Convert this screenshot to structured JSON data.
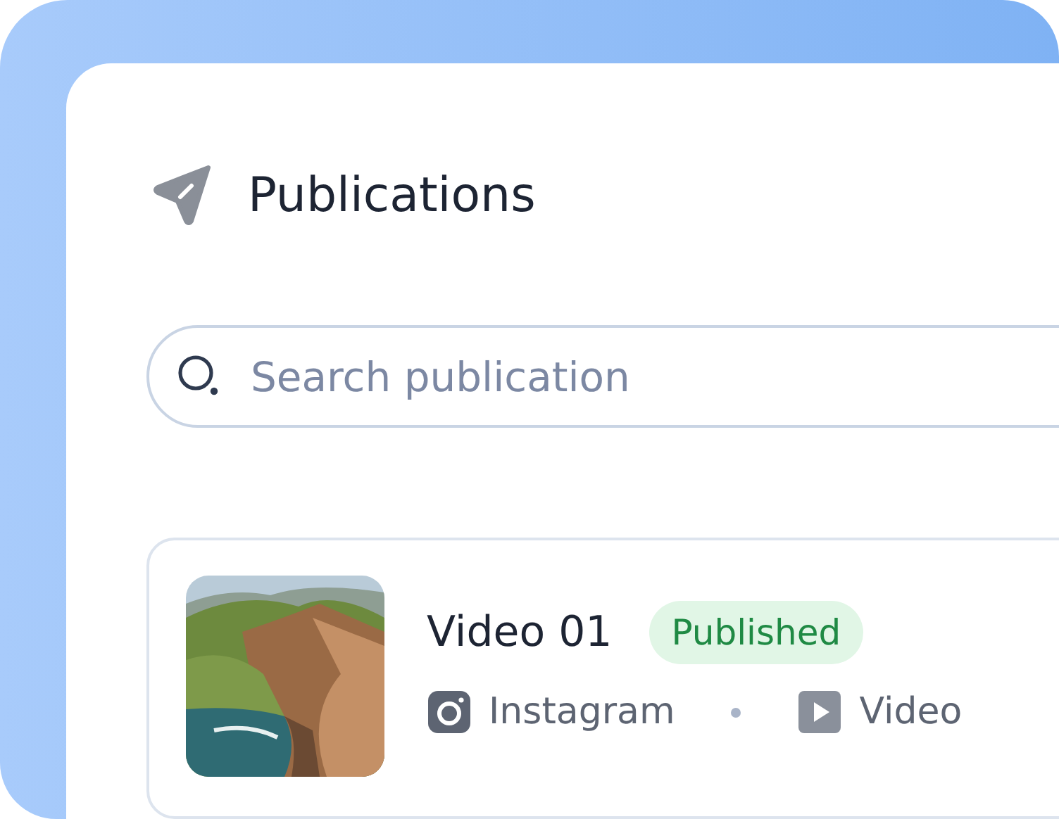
{
  "title": "Publications",
  "search": {
    "placeholder": "Search publication"
  },
  "publications": [
    {
      "title": "Video 01",
      "status": {
        "label": "Published",
        "kind": "published"
      },
      "platform": "Instagram",
      "type": "Video"
    }
  ]
}
